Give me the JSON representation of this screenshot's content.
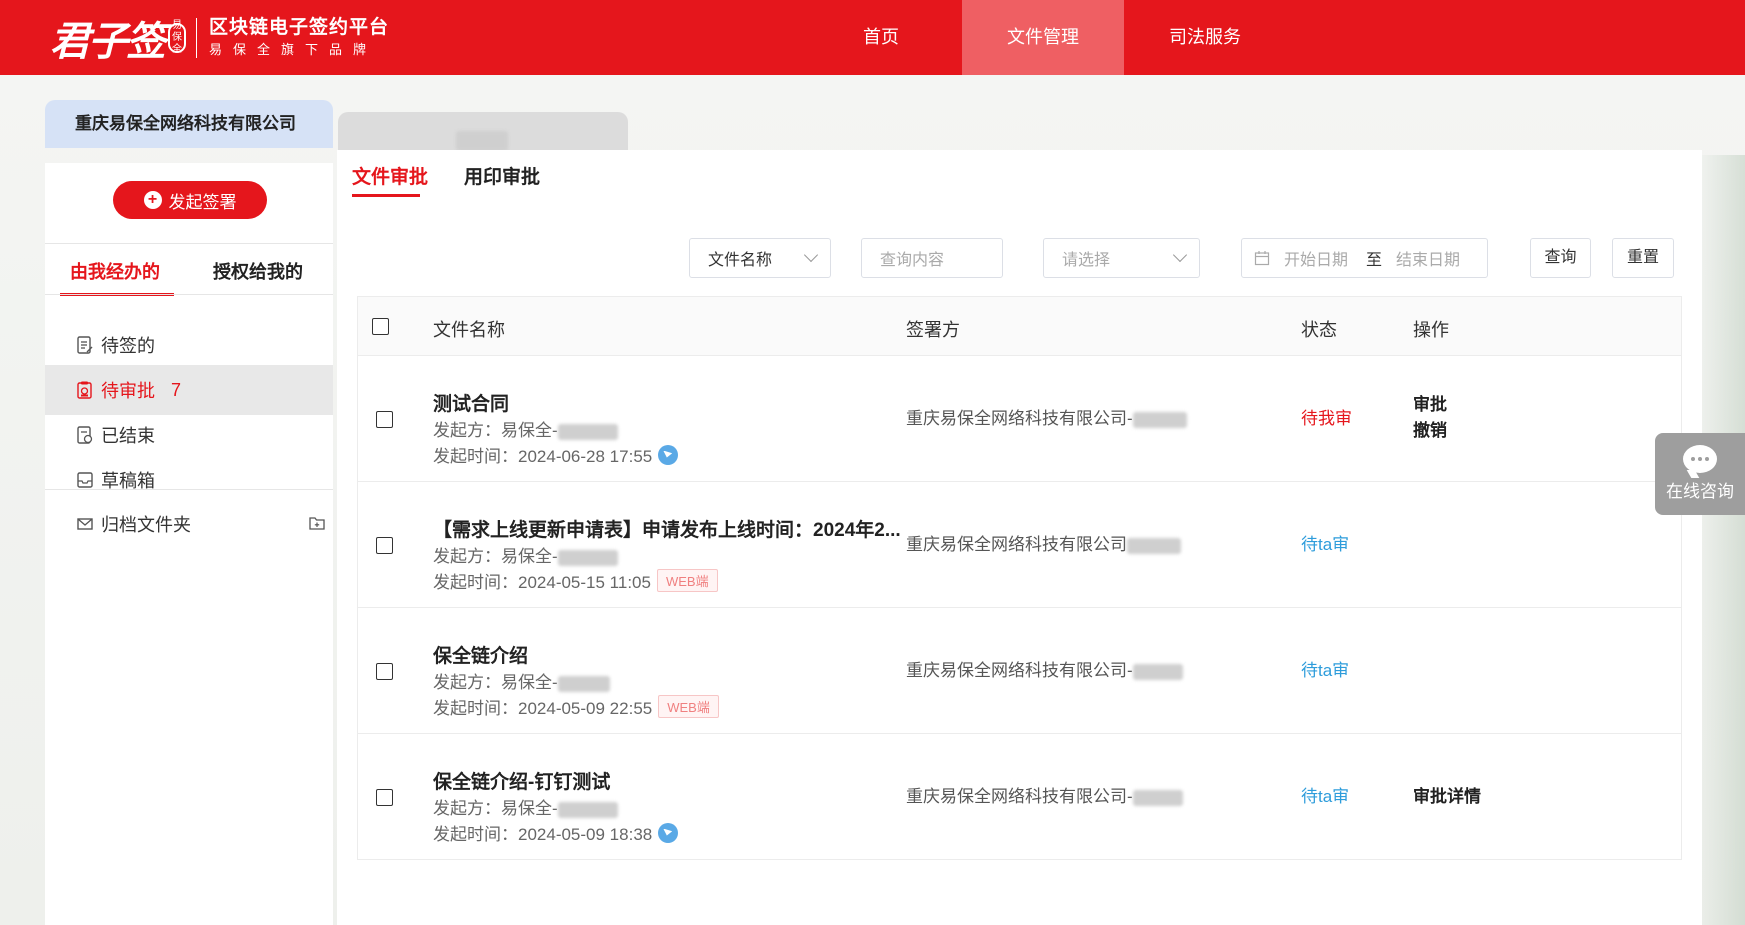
{
  "header": {
    "logo_mark": "君子签",
    "logo_seal": "易保全",
    "platform_title": "区块链电子签约平台",
    "platform_sub": "易保全旗下品牌",
    "nav": [
      {
        "label": "首页"
      },
      {
        "label": "文件管理"
      },
      {
        "label": "司法服务"
      }
    ]
  },
  "company_tabs": [
    {
      "label": "重庆易保全网络科技有限公司"
    }
  ],
  "sidebar": {
    "new_sign_label": "发起签署",
    "tabs": [
      {
        "label": "由我经办的"
      },
      {
        "label": "授权给我的"
      }
    ],
    "menu": [
      {
        "label": "待签的",
        "count": ""
      },
      {
        "label": "待审批",
        "count": "7"
      },
      {
        "label": "已结束",
        "count": ""
      },
      {
        "label": "草稿箱",
        "count": ""
      }
    ],
    "archive_label": "归档文件夹"
  },
  "main": {
    "tabs": [
      {
        "label": "文件审批"
      },
      {
        "label": "用印审批"
      }
    ],
    "filters": {
      "field_select": "文件名称",
      "query_placeholder": "查询内容",
      "status_placeholder": "请选择",
      "start_placeholder": "开始日期",
      "range_sep": "至",
      "end_placeholder": "结束日期",
      "search_label": "查询",
      "reset_label": "重置"
    },
    "table": {
      "headers": {
        "name": "文件名称",
        "party": "签署方",
        "status": "状态",
        "op": "操作"
      },
      "rows": [
        {
          "name": "测试合同",
          "sender": "发起方：易保全-",
          "time": "发起时间：2024-06-28 17:55",
          "source": "",
          "party": "重庆易保全网络科技有限公司-",
          "status": "待我审",
          "ops": [
            "审批",
            "撤销"
          ]
        },
        {
          "name": "【需求上线更新申请表】申请发布上线时间：2024年2...",
          "sender": "发起方：易保全-",
          "time": "发起时间：2024-05-15 11:05",
          "source": "WEB端",
          "party": "重庆易保全网络科技有限公司",
          "status": "待ta审",
          "ops": []
        },
        {
          "name": "保全链介绍",
          "sender": "发起方：易保全-",
          "time": "发起时间：2024-05-09 22:55",
          "source": "WEB端",
          "party": "重庆易保全网络科技有限公司-",
          "status": "待ta审",
          "ops": []
        },
        {
          "name": "保全链介绍-钉钉测试",
          "sender": "发起方：易保全-",
          "time": "发起时间：2024-05-09 18:38",
          "source": "",
          "party": "重庆易保全网络科技有限公司-",
          "status": "待ta审",
          "ops": [
            "审批详情"
          ]
        }
      ]
    }
  },
  "float_consult": {
    "label": "在线咨询"
  },
  "colors": {
    "brand": "#e5161c",
    "nav_active": "#ef5f63",
    "status_pending_me": "#e5161c",
    "status_pending_other": "#2d9cdb",
    "company_tab": "#d6e2f6"
  }
}
